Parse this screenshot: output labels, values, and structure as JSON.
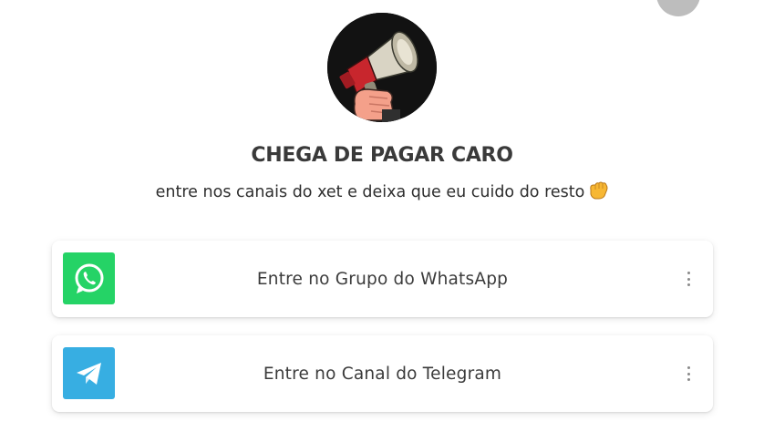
{
  "profile": {
    "title": "CHEGA DE PAGAR CARO",
    "bio": "entre nos canais do xet e deixa que eu cuido do resto",
    "bio_emoji": "fist-icon",
    "avatar_icon": "megaphone-icon"
  },
  "links": [
    {
      "label": "Entre no Grupo do WhatsApp",
      "icon": "whatsapp-icon",
      "icon_color": "#25d366"
    },
    {
      "label": "Entre no Canal do Telegram",
      "icon": "telegram-icon",
      "icon_color": "#37aee2"
    }
  ],
  "colors": {
    "background": "#ffffff",
    "whatsapp": "#25d366",
    "telegram": "#37aee2",
    "corner_avatar": "#bdbdbd"
  }
}
